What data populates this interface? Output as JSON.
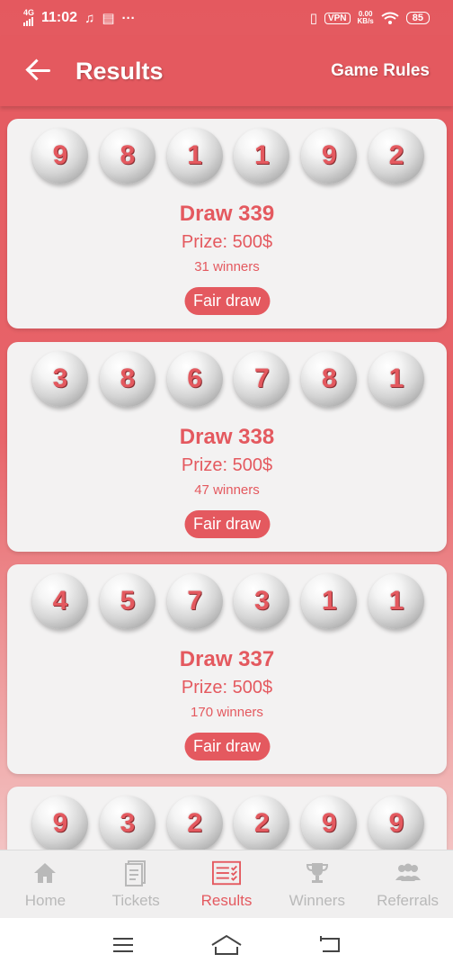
{
  "status_bar": {
    "network": "4G",
    "time": "11:02",
    "vpn": "VPN",
    "speed_value": "0.00",
    "speed_unit": "KB/s",
    "battery": "85"
  },
  "header": {
    "title": "Results",
    "rules_label": "Game Rules"
  },
  "draws": [
    {
      "numbers": [
        "9",
        "8",
        "1",
        "1",
        "9",
        "2"
      ],
      "title": "Draw 339",
      "prize": "Prize: 500$",
      "winners": "31 winners",
      "fair_label": "Fair draw"
    },
    {
      "numbers": [
        "3",
        "8",
        "6",
        "7",
        "8",
        "1"
      ],
      "title": "Draw 338",
      "prize": "Prize: 500$",
      "winners": "47 winners",
      "fair_label": "Fair draw"
    },
    {
      "numbers": [
        "4",
        "5",
        "7",
        "3",
        "1",
        "1"
      ],
      "title": "Draw 337",
      "prize": "Prize: 500$",
      "winners": "170 winners",
      "fair_label": "Fair draw"
    },
    {
      "numbers": [
        "9",
        "3",
        "2",
        "2",
        "9",
        "9"
      ]
    }
  ],
  "bottom_nav": {
    "items": [
      {
        "label": "Home",
        "icon": "home-icon"
      },
      {
        "label": "Tickets",
        "icon": "tickets-icon"
      },
      {
        "label": "Results",
        "icon": "results-icon",
        "active": true
      },
      {
        "label": "Winners",
        "icon": "trophy-icon"
      },
      {
        "label": "Referrals",
        "icon": "referrals-icon"
      }
    ]
  },
  "colors": {
    "accent": "#e4595f",
    "inactive": "#b9b9b9",
    "card": "#f3f2f2"
  }
}
